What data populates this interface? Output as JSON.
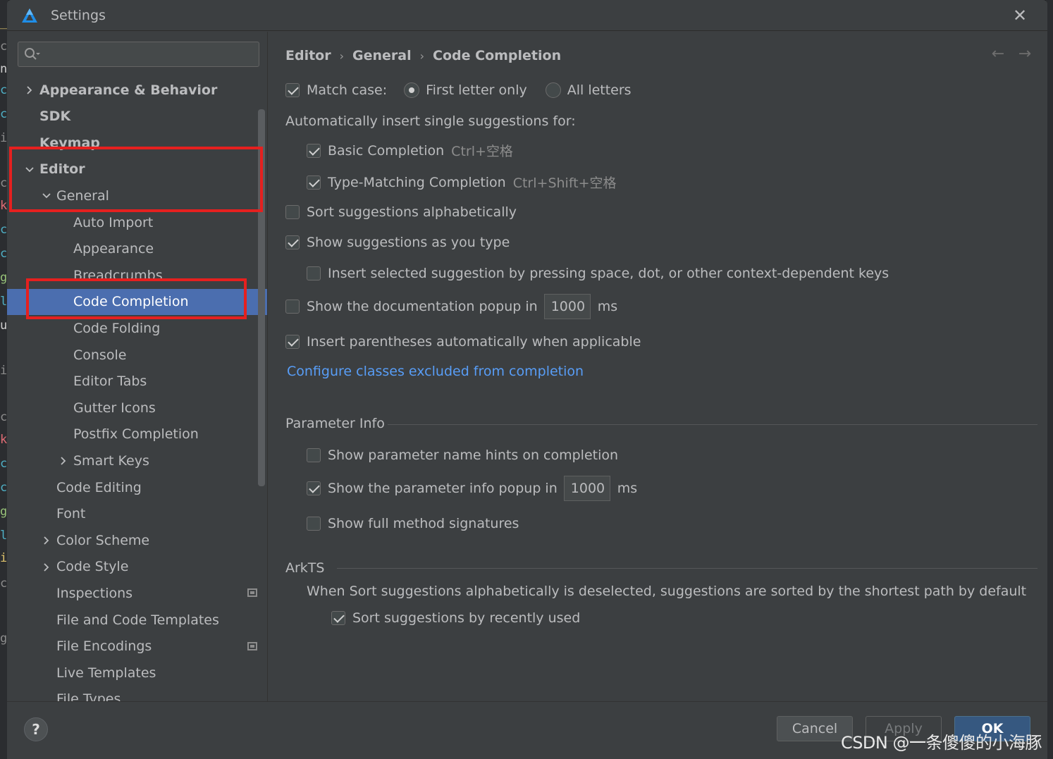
{
  "window": {
    "title": "Settings"
  },
  "search": {
    "placeholder": ""
  },
  "tree": [
    {
      "label": "Appearance & Behavior",
      "bold": true,
      "arrow": "right",
      "level": 0
    },
    {
      "label": "SDK",
      "bold": true,
      "arrow": "none",
      "level": 0
    },
    {
      "label": "Keymap",
      "bold": true,
      "arrow": "none",
      "level": 0
    },
    {
      "label": "Editor",
      "bold": true,
      "arrow": "down",
      "level": 0
    },
    {
      "label": "General",
      "bold": false,
      "arrow": "down",
      "level": 1
    },
    {
      "label": "Auto Import",
      "bold": false,
      "arrow": "none",
      "level": 2
    },
    {
      "label": "Appearance",
      "bold": false,
      "arrow": "none",
      "level": 2
    },
    {
      "label": "Breadcrumbs",
      "bold": false,
      "arrow": "none",
      "level": 2
    },
    {
      "label": "Code Completion",
      "bold": false,
      "arrow": "none",
      "level": 2,
      "selected": true
    },
    {
      "label": "Code Folding",
      "bold": false,
      "arrow": "none",
      "level": 2
    },
    {
      "label": "Console",
      "bold": false,
      "arrow": "none",
      "level": 2
    },
    {
      "label": "Editor Tabs",
      "bold": false,
      "arrow": "none",
      "level": 2
    },
    {
      "label": "Gutter Icons",
      "bold": false,
      "arrow": "none",
      "level": 2
    },
    {
      "label": "Postfix Completion",
      "bold": false,
      "arrow": "none",
      "level": 2
    },
    {
      "label": "Smart Keys",
      "bold": false,
      "arrow": "right",
      "level": 2
    },
    {
      "label": "Code Editing",
      "bold": false,
      "arrow": "none",
      "level": 1
    },
    {
      "label": "Font",
      "bold": false,
      "arrow": "none",
      "level": 1
    },
    {
      "label": "Color Scheme",
      "bold": false,
      "arrow": "right",
      "level": 1
    },
    {
      "label": "Code Style",
      "bold": false,
      "arrow": "right",
      "level": 1
    },
    {
      "label": "Inspections",
      "bold": false,
      "arrow": "none",
      "level": 1,
      "badge": true
    },
    {
      "label": "File and Code Templates",
      "bold": false,
      "arrow": "none",
      "level": 1
    },
    {
      "label": "File Encodings",
      "bold": false,
      "arrow": "none",
      "level": 1,
      "badge": true
    },
    {
      "label": "Live Templates",
      "bold": false,
      "arrow": "none",
      "level": 1
    },
    {
      "label": "File Types",
      "bold": false,
      "arrow": "none",
      "level": 1
    }
  ],
  "breadcrumb": [
    "Editor",
    "General",
    "Code Completion"
  ],
  "content": {
    "match_case": {
      "label": "Match case:",
      "checked": true
    },
    "radio_first_letter": {
      "label": "First letter only",
      "checked": true
    },
    "radio_all_letters": {
      "label": "All letters",
      "checked": false
    },
    "auto_insert_heading": "Automatically insert single suggestions for:",
    "basic_completion": {
      "label": "Basic Completion",
      "shortcut": "Ctrl+空格",
      "checked": true
    },
    "type_matching": {
      "label": "Type-Matching Completion",
      "shortcut": "Ctrl+Shift+空格",
      "checked": true
    },
    "sort_alpha": {
      "label": "Sort suggestions alphabetically",
      "checked": false
    },
    "show_as_type": {
      "label": "Show suggestions as you type",
      "checked": true
    },
    "insert_selected": {
      "label": "Insert selected suggestion by pressing space, dot, or other context-dependent keys",
      "checked": false
    },
    "doc_popup": {
      "label": "Show the documentation popup in",
      "value": "1000",
      "unit": "ms",
      "checked": false
    },
    "insert_parens": {
      "label": "Insert parentheses automatically when applicable",
      "checked": true
    },
    "configure_link": "Configure classes excluded from completion",
    "param_info": {
      "title": "Parameter Info",
      "name_hints": {
        "label": "Show parameter name hints on completion",
        "checked": false
      },
      "info_popup": {
        "label": "Show the parameter info popup in",
        "value": "1000",
        "unit": "ms",
        "checked": true
      },
      "full_signatures": {
        "label": "Show full method signatures",
        "checked": false
      }
    },
    "arkts": {
      "title": "ArkTS",
      "note": "When Sort suggestions alphabetically is deselected, suggestions are sorted by the shortest path by default",
      "recently_used": {
        "label": "Sort suggestions by recently used",
        "checked": true
      }
    }
  },
  "buttons": {
    "cancel": "Cancel",
    "apply": "Apply",
    "ok": "OK",
    "help": "?"
  },
  "watermark": "CSDN @一条傻傻的小海豚",
  "colors": {
    "selection": "#4b6eaf",
    "highlight_box": "#e5201f",
    "link": "#589df6",
    "ok_button": "#365880"
  }
}
